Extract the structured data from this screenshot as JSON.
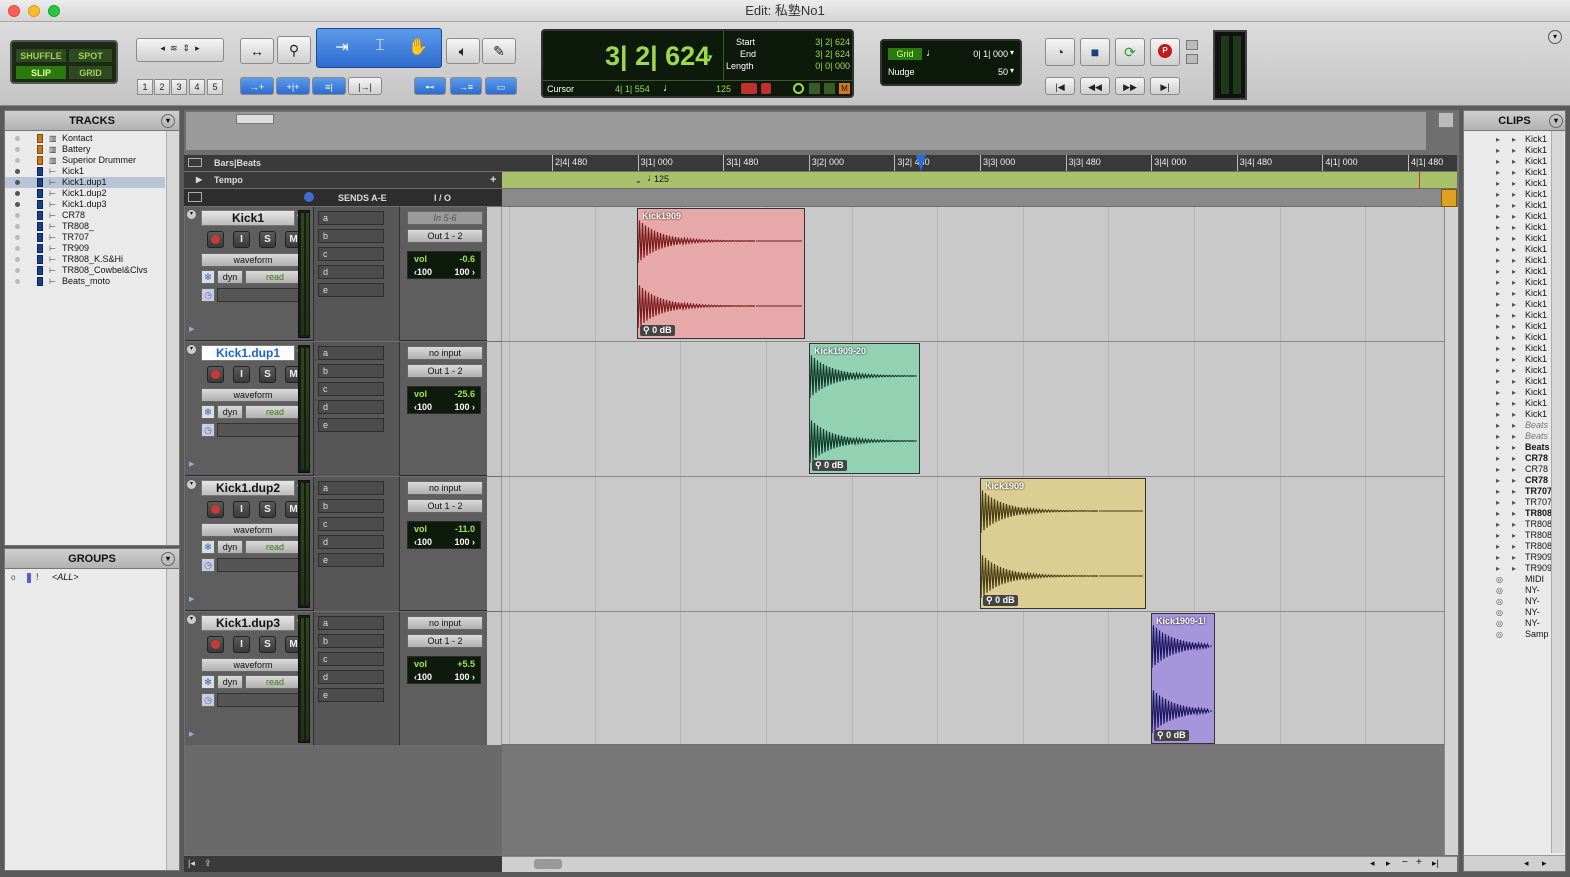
{
  "window": {
    "title": "Edit: 私塾No1"
  },
  "toolbar": {
    "modes": {
      "shuffle": "SHUFFLE",
      "spot": "SPOT",
      "slip": "SLIP",
      "grid": "GRID"
    },
    "zoom_presets": [
      "1",
      "2",
      "3",
      "4",
      "5"
    ]
  },
  "counter": {
    "main": "3| 2| 624",
    "start_label": "Start",
    "start_value": "3| 2| 624",
    "end_label": "End",
    "end_value": "3| 2| 624",
    "length_label": "Length",
    "length_value": "0| 0| 000",
    "cursor_label": "Cursor",
    "cursor_value": "4| 1| 554",
    "tempo_value": "125"
  },
  "grid_nudge": {
    "grid_label": "Grid",
    "grid_value": "0| 1| 000",
    "nudge_label": "Nudge",
    "nudge_value": "50"
  },
  "tracks_panel": {
    "title": "TRACKS",
    "items": [
      {
        "name": "Kontact",
        "icon": "instrument"
      },
      {
        "name": "Battery",
        "icon": "instrument"
      },
      {
        "name": "Superior Drummer",
        "icon": "instrument"
      },
      {
        "name": "Kick1",
        "icon": "audio"
      },
      {
        "name": "Kick1.dup1",
        "icon": "audio",
        "selected": true
      },
      {
        "name": "Kick1.dup2",
        "icon": "audio"
      },
      {
        "name": "Kick1.dup3",
        "icon": "audio"
      },
      {
        "name": "CR78",
        "icon": "audio"
      },
      {
        "name": "TR808_",
        "icon": "audio"
      },
      {
        "name": "TR707",
        "icon": "audio"
      },
      {
        "name": "TR909",
        "icon": "audio"
      },
      {
        "name": "TR808_K.S&Hi",
        "icon": "audio"
      },
      {
        "name": "TR808_Cowbel&Clvs",
        "icon": "audio"
      },
      {
        "name": "Beats_moto",
        "icon": "audio"
      }
    ]
  },
  "groups_panel": {
    "title": "GROUPS",
    "all_label": "<ALL>"
  },
  "rulers": {
    "bars_label": "Bars|Beats",
    "tempo_label": "Tempo",
    "tempo_marker": "125",
    "ticks": [
      "2|4| 480",
      "3|1| 000",
      "3|1| 480",
      "3|2| 000",
      "3|2| 480",
      "3|3| 000",
      "3|3| 480",
      "3|4| 000",
      "3|4| 480",
      "4|1| 000",
      "4|1| 480"
    ]
  },
  "columns": {
    "sends": "SENDS A-E",
    "io": "I / O"
  },
  "tracks": [
    {
      "name": "Kick1",
      "view": "waveform",
      "auto": "read",
      "input": "In 5-6",
      "output": "Out 1 - 2",
      "vol_label": "vol",
      "vol": "-0.6",
      "pan_l": "‹100",
      "pan_r": "100 ›",
      "clip": {
        "name": "Kick1909",
        "gain": "0 dB",
        "color": "#e6a8a8",
        "wave": "#7a1a1a"
      }
    },
    {
      "name": "Kick1.dup1",
      "view": "waveform",
      "auto": "read",
      "input": "no input",
      "output": "Out 1 - 2",
      "vol_label": "vol",
      "vol": "-25.6",
      "pan_l": "‹100",
      "pan_r": "100 ›",
      "clip": {
        "name": "Kick1909-20",
        "gain": "0 dB",
        "color": "#93d1b3",
        "wave": "#0e3b2a"
      }
    },
    {
      "name": "Kick1.dup2",
      "view": "waveform",
      "auto": "read",
      "input": "no input",
      "output": "Out 1 - 2",
      "vol_label": "vol",
      "vol": "-11.0",
      "pan_l": "‹100",
      "pan_r": "100 ›",
      "clip": {
        "name": "Kick1909",
        "gain": "0 dB",
        "color": "#dccd92",
        "wave": "#4a3c10"
      }
    },
    {
      "name": "Kick1.dup3",
      "view": "waveform",
      "auto": "read",
      "input": "no input",
      "output": "Out 1 - 2",
      "vol_label": "vol",
      "vol": "+5.5",
      "pan_l": "‹100",
      "pan_r": "100 ›",
      "clip": {
        "name": "Kick1909-1!",
        "gain": "0 dB",
        "color": "#a596dc",
        "wave": "#1e1660"
      }
    }
  ],
  "send_slots": [
    "a",
    "b",
    "c",
    "d",
    "e"
  ],
  "dyn_label": "dyn",
  "clips_panel": {
    "title": "CLIPS",
    "items": [
      {
        "t": "Kick1",
        "s": ""
      },
      {
        "t": "Kick1",
        "s": ""
      },
      {
        "t": "Kick1",
        "s": ""
      },
      {
        "t": "Kick1",
        "s": ""
      },
      {
        "t": "Kick1",
        "s": ""
      },
      {
        "t": "Kick1",
        "s": ""
      },
      {
        "t": "Kick1",
        "s": ""
      },
      {
        "t": "Kick1",
        "s": ""
      },
      {
        "t": "Kick1",
        "s": ""
      },
      {
        "t": "Kick1",
        "s": ""
      },
      {
        "t": "Kick1",
        "s": ""
      },
      {
        "t": "Kick1",
        "s": ""
      },
      {
        "t": "Kick1",
        "s": ""
      },
      {
        "t": "Kick1",
        "s": ""
      },
      {
        "t": "Kick1",
        "s": ""
      },
      {
        "t": "Kick1",
        "s": ""
      },
      {
        "t": "Kick1",
        "s": ""
      },
      {
        "t": "Kick1",
        "s": ""
      },
      {
        "t": "Kick1",
        "s": ""
      },
      {
        "t": "Kick1",
        "s": ""
      },
      {
        "t": "Kick1",
        "s": ""
      },
      {
        "t": "Kick1",
        "s": ""
      },
      {
        "t": "Kick1",
        "s": ""
      },
      {
        "t": "Kick1",
        "s": ""
      },
      {
        "t": "Kick1",
        "s": ""
      },
      {
        "t": "Kick1",
        "s": ""
      },
      {
        "t": "Beats",
        "s": "i"
      },
      {
        "t": "Beats",
        "s": "i"
      },
      {
        "t": "Beats",
        "s": "b"
      },
      {
        "t": "CR78",
        "s": "b"
      },
      {
        "t": "CR78",
        "s": ""
      },
      {
        "t": "CR78",
        "s": "b"
      },
      {
        "t": "TR707",
        "s": "b"
      },
      {
        "t": "TR707",
        "s": ""
      },
      {
        "t": "TR808",
        "s": "b"
      },
      {
        "t": "TR808",
        "s": ""
      },
      {
        "t": "TR808",
        "s": ""
      },
      {
        "t": "TR808",
        "s": ""
      },
      {
        "t": "TR909",
        "s": ""
      },
      {
        "t": "TR909",
        "s": ""
      },
      {
        "t": "MIDI",
        "s": ""
      },
      {
        "t": "NY-",
        "s": ""
      },
      {
        "t": "NY-",
        "s": ""
      },
      {
        "t": "NY-",
        "s": ""
      },
      {
        "t": "NY-",
        "s": ""
      },
      {
        "t": "Samp",
        "s": ""
      }
    ]
  },
  "colors": {
    "lcd_green": "#9fd84a",
    "ruler_dark": "#3a3a3a",
    "tempo_bar": "#a7c26a",
    "playhead": "#2a6fd8"
  }
}
